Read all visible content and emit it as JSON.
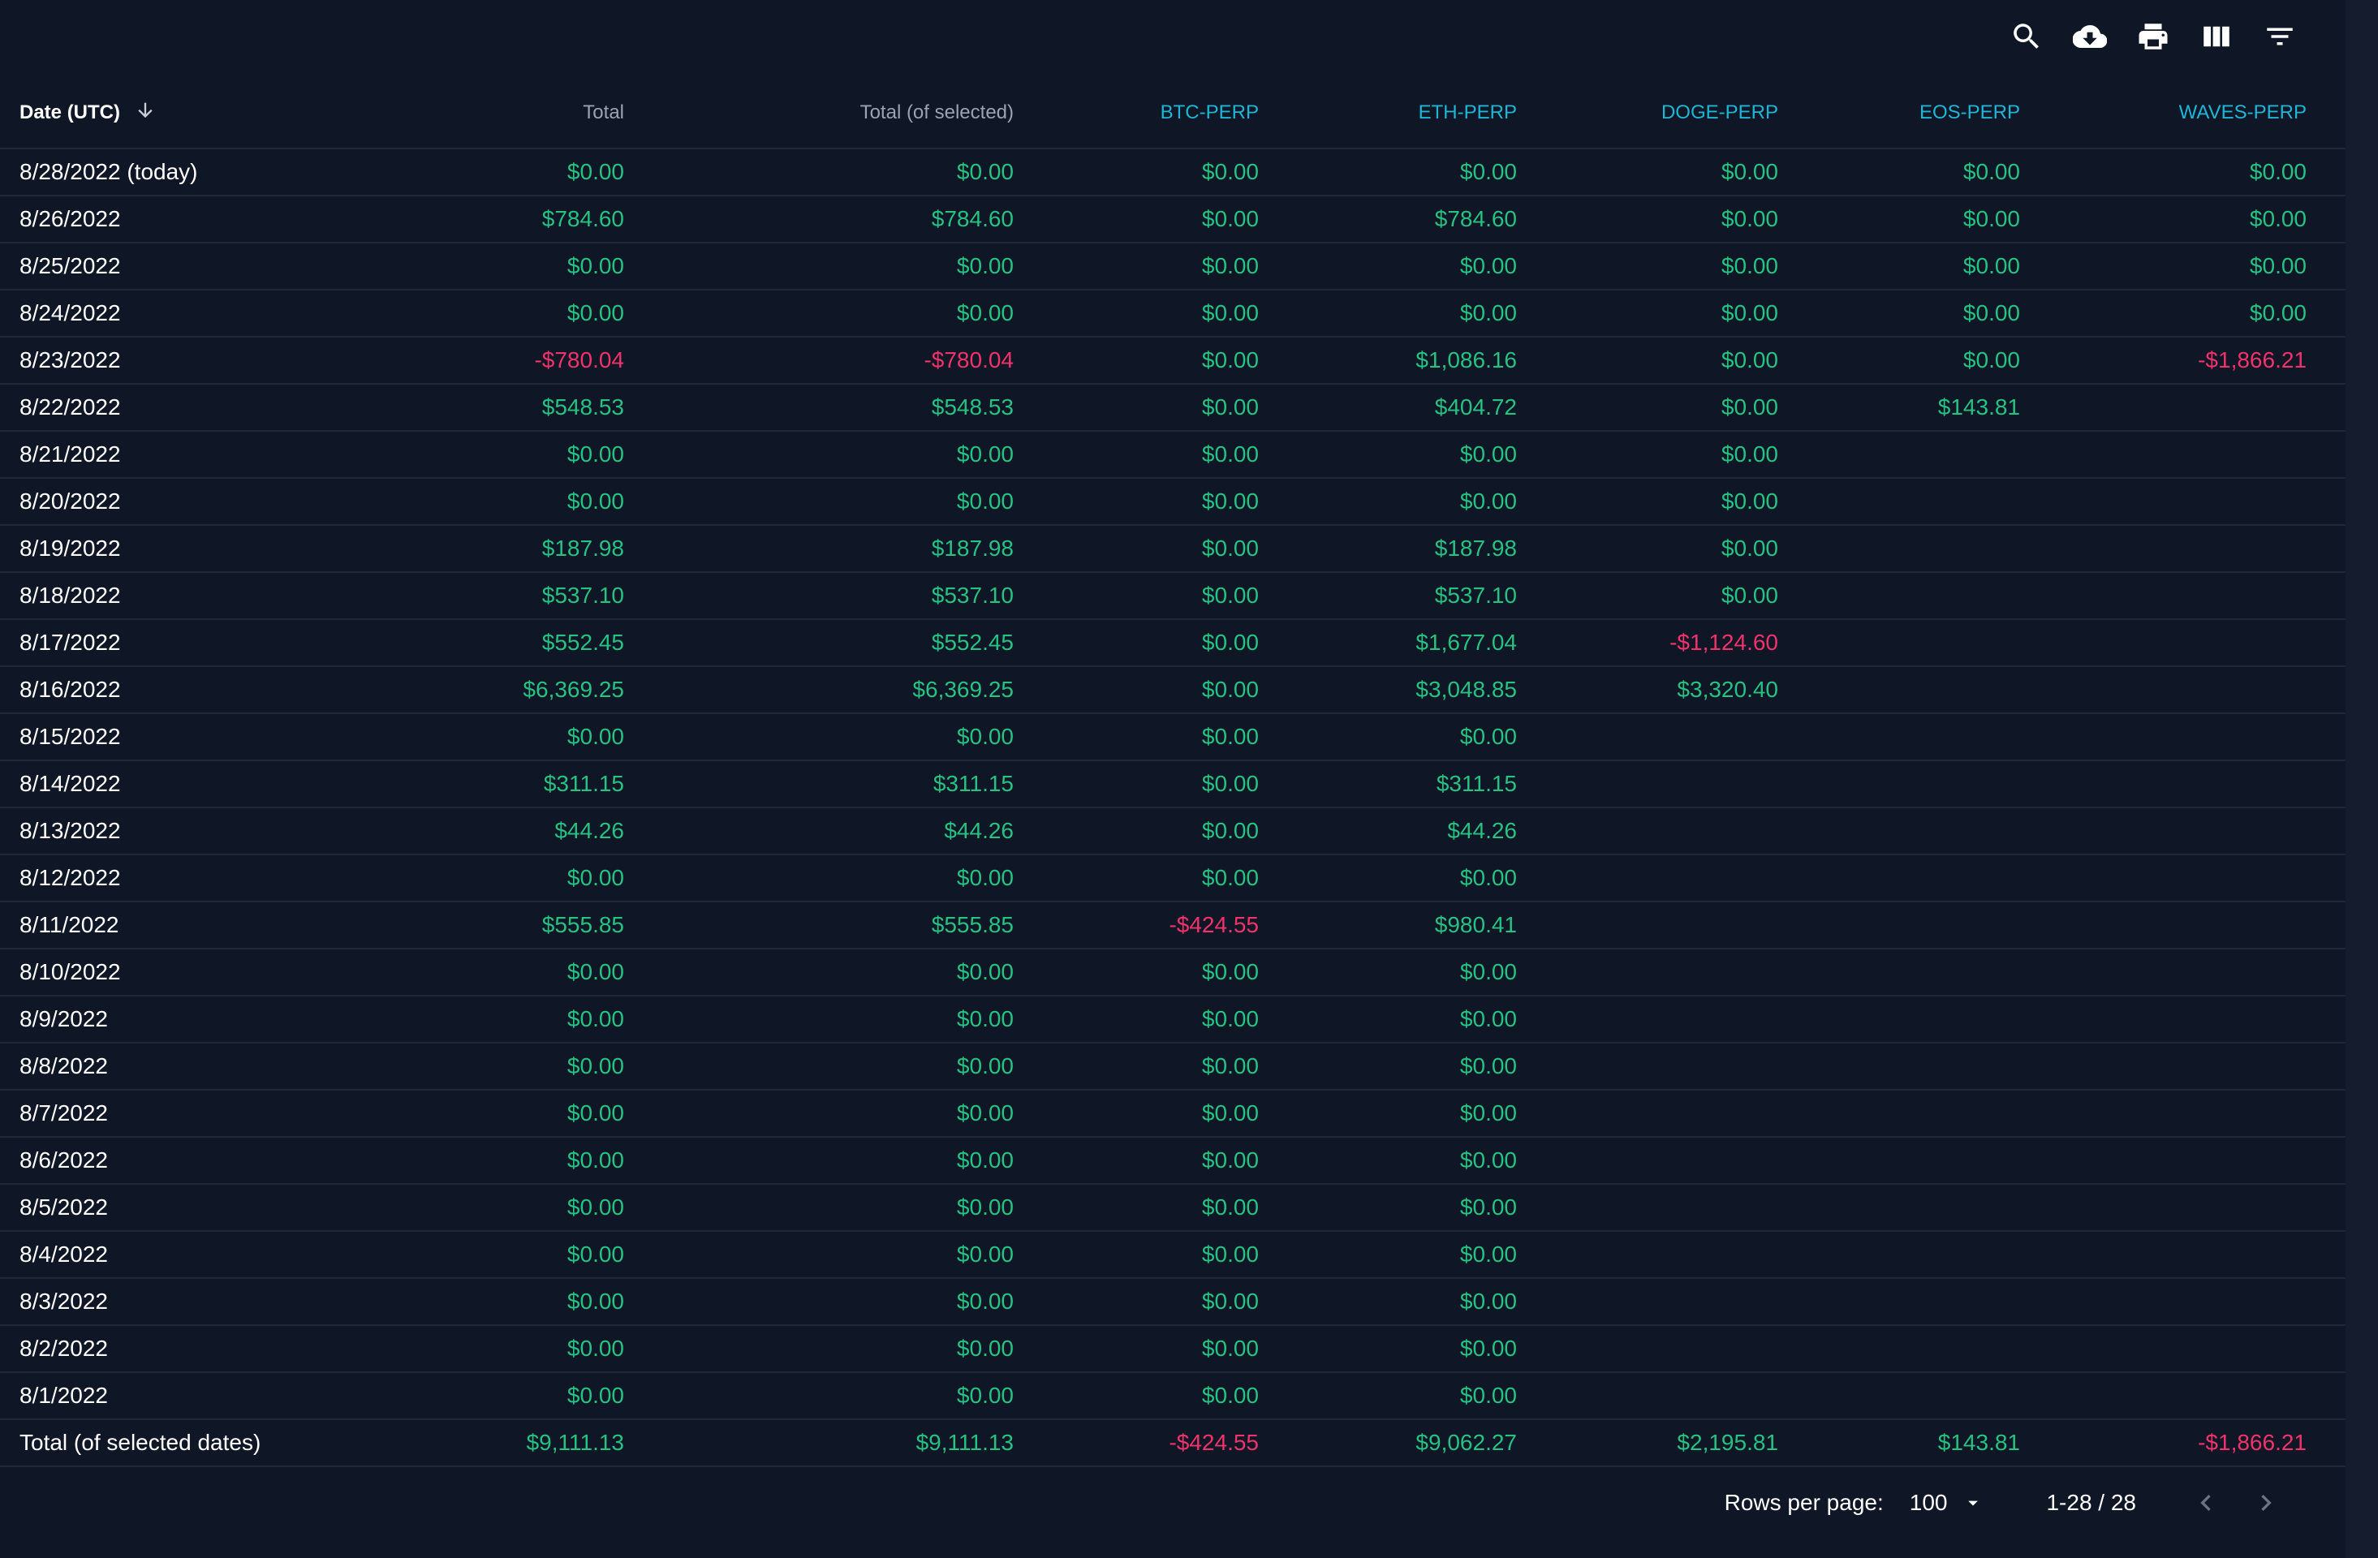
{
  "toolbar": {
    "icons": [
      "search-icon",
      "cloud-download-icon",
      "print-icon",
      "view-columns-icon",
      "filter-list-icon"
    ]
  },
  "table": {
    "columns": [
      "Date (UTC)",
      "Total",
      "Total (of selected)",
      "BTC-PERP",
      "ETH-PERP",
      "DOGE-PERP",
      "EOS-PERP",
      "WAVES-PERP"
    ],
    "rows": [
      [
        "8/28/2022 (today)",
        "$0.00",
        "$0.00",
        "$0.00",
        "$0.00",
        "$0.00",
        "$0.00",
        "$0.00"
      ],
      [
        "8/26/2022",
        "$784.60",
        "$784.60",
        "$0.00",
        "$784.60",
        "$0.00",
        "$0.00",
        "$0.00"
      ],
      [
        "8/25/2022",
        "$0.00",
        "$0.00",
        "$0.00",
        "$0.00",
        "$0.00",
        "$0.00",
        "$0.00"
      ],
      [
        "8/24/2022",
        "$0.00",
        "$0.00",
        "$0.00",
        "$0.00",
        "$0.00",
        "$0.00",
        "$0.00"
      ],
      [
        "8/23/2022",
        "-$780.04",
        "-$780.04",
        "$0.00",
        "$1,086.16",
        "$0.00",
        "$0.00",
        "-$1,866.21"
      ],
      [
        "8/22/2022",
        "$548.53",
        "$548.53",
        "$0.00",
        "$404.72",
        "$0.00",
        "$143.81",
        ""
      ],
      [
        "8/21/2022",
        "$0.00",
        "$0.00",
        "$0.00",
        "$0.00",
        "$0.00",
        "",
        ""
      ],
      [
        "8/20/2022",
        "$0.00",
        "$0.00",
        "$0.00",
        "$0.00",
        "$0.00",
        "",
        ""
      ],
      [
        "8/19/2022",
        "$187.98",
        "$187.98",
        "$0.00",
        "$187.98",
        "$0.00",
        "",
        ""
      ],
      [
        "8/18/2022",
        "$537.10",
        "$537.10",
        "$0.00",
        "$537.10",
        "$0.00",
        "",
        ""
      ],
      [
        "8/17/2022",
        "$552.45",
        "$552.45",
        "$0.00",
        "$1,677.04",
        "-$1,124.60",
        "",
        ""
      ],
      [
        "8/16/2022",
        "$6,369.25",
        "$6,369.25",
        "$0.00",
        "$3,048.85",
        "$3,320.40",
        "",
        ""
      ],
      [
        "8/15/2022",
        "$0.00",
        "$0.00",
        "$0.00",
        "$0.00",
        "",
        "",
        ""
      ],
      [
        "8/14/2022",
        "$311.15",
        "$311.15",
        "$0.00",
        "$311.15",
        "",
        "",
        ""
      ],
      [
        "8/13/2022",
        "$44.26",
        "$44.26",
        "$0.00",
        "$44.26",
        "",
        "",
        ""
      ],
      [
        "8/12/2022",
        "$0.00",
        "$0.00",
        "$0.00",
        "$0.00",
        "",
        "",
        ""
      ],
      [
        "8/11/2022",
        "$555.85",
        "$555.85",
        "-$424.55",
        "$980.41",
        "",
        "",
        ""
      ],
      [
        "8/10/2022",
        "$0.00",
        "$0.00",
        "$0.00",
        "$0.00",
        "",
        "",
        ""
      ],
      [
        "8/9/2022",
        "$0.00",
        "$0.00",
        "$0.00",
        "$0.00",
        "",
        "",
        ""
      ],
      [
        "8/8/2022",
        "$0.00",
        "$0.00",
        "$0.00",
        "$0.00",
        "",
        "",
        ""
      ],
      [
        "8/7/2022",
        "$0.00",
        "$0.00",
        "$0.00",
        "$0.00",
        "",
        "",
        ""
      ],
      [
        "8/6/2022",
        "$0.00",
        "$0.00",
        "$0.00",
        "$0.00",
        "",
        "",
        ""
      ],
      [
        "8/5/2022",
        "$0.00",
        "$0.00",
        "$0.00",
        "$0.00",
        "",
        "",
        ""
      ],
      [
        "8/4/2022",
        "$0.00",
        "$0.00",
        "$0.00",
        "$0.00",
        "",
        "",
        ""
      ],
      [
        "8/3/2022",
        "$0.00",
        "$0.00",
        "$0.00",
        "$0.00",
        "",
        "",
        ""
      ],
      [
        "8/2/2022",
        "$0.00",
        "$0.00",
        "$0.00",
        "$0.00",
        "",
        "",
        ""
      ],
      [
        "8/1/2022",
        "$0.00",
        "$0.00",
        "$0.00",
        "$0.00",
        "",
        "",
        ""
      ]
    ],
    "total_row": [
      "Total (of selected dates)",
      "$9,111.13",
      "$9,111.13",
      "-$424.55",
      "$9,062.27",
      "$2,195.81",
      "$143.81",
      "-$1,866.21"
    ]
  },
  "pagination": {
    "rows_per_page_label": "Rows per page:",
    "rows_per_page_value": "100",
    "range": "1-28 / 28"
  },
  "colors": {
    "background": "#0f1626",
    "positive": "#27c281",
    "negative": "#f0336a",
    "symbol_header": "#1fb6d6",
    "divider": "#1f2839"
  }
}
